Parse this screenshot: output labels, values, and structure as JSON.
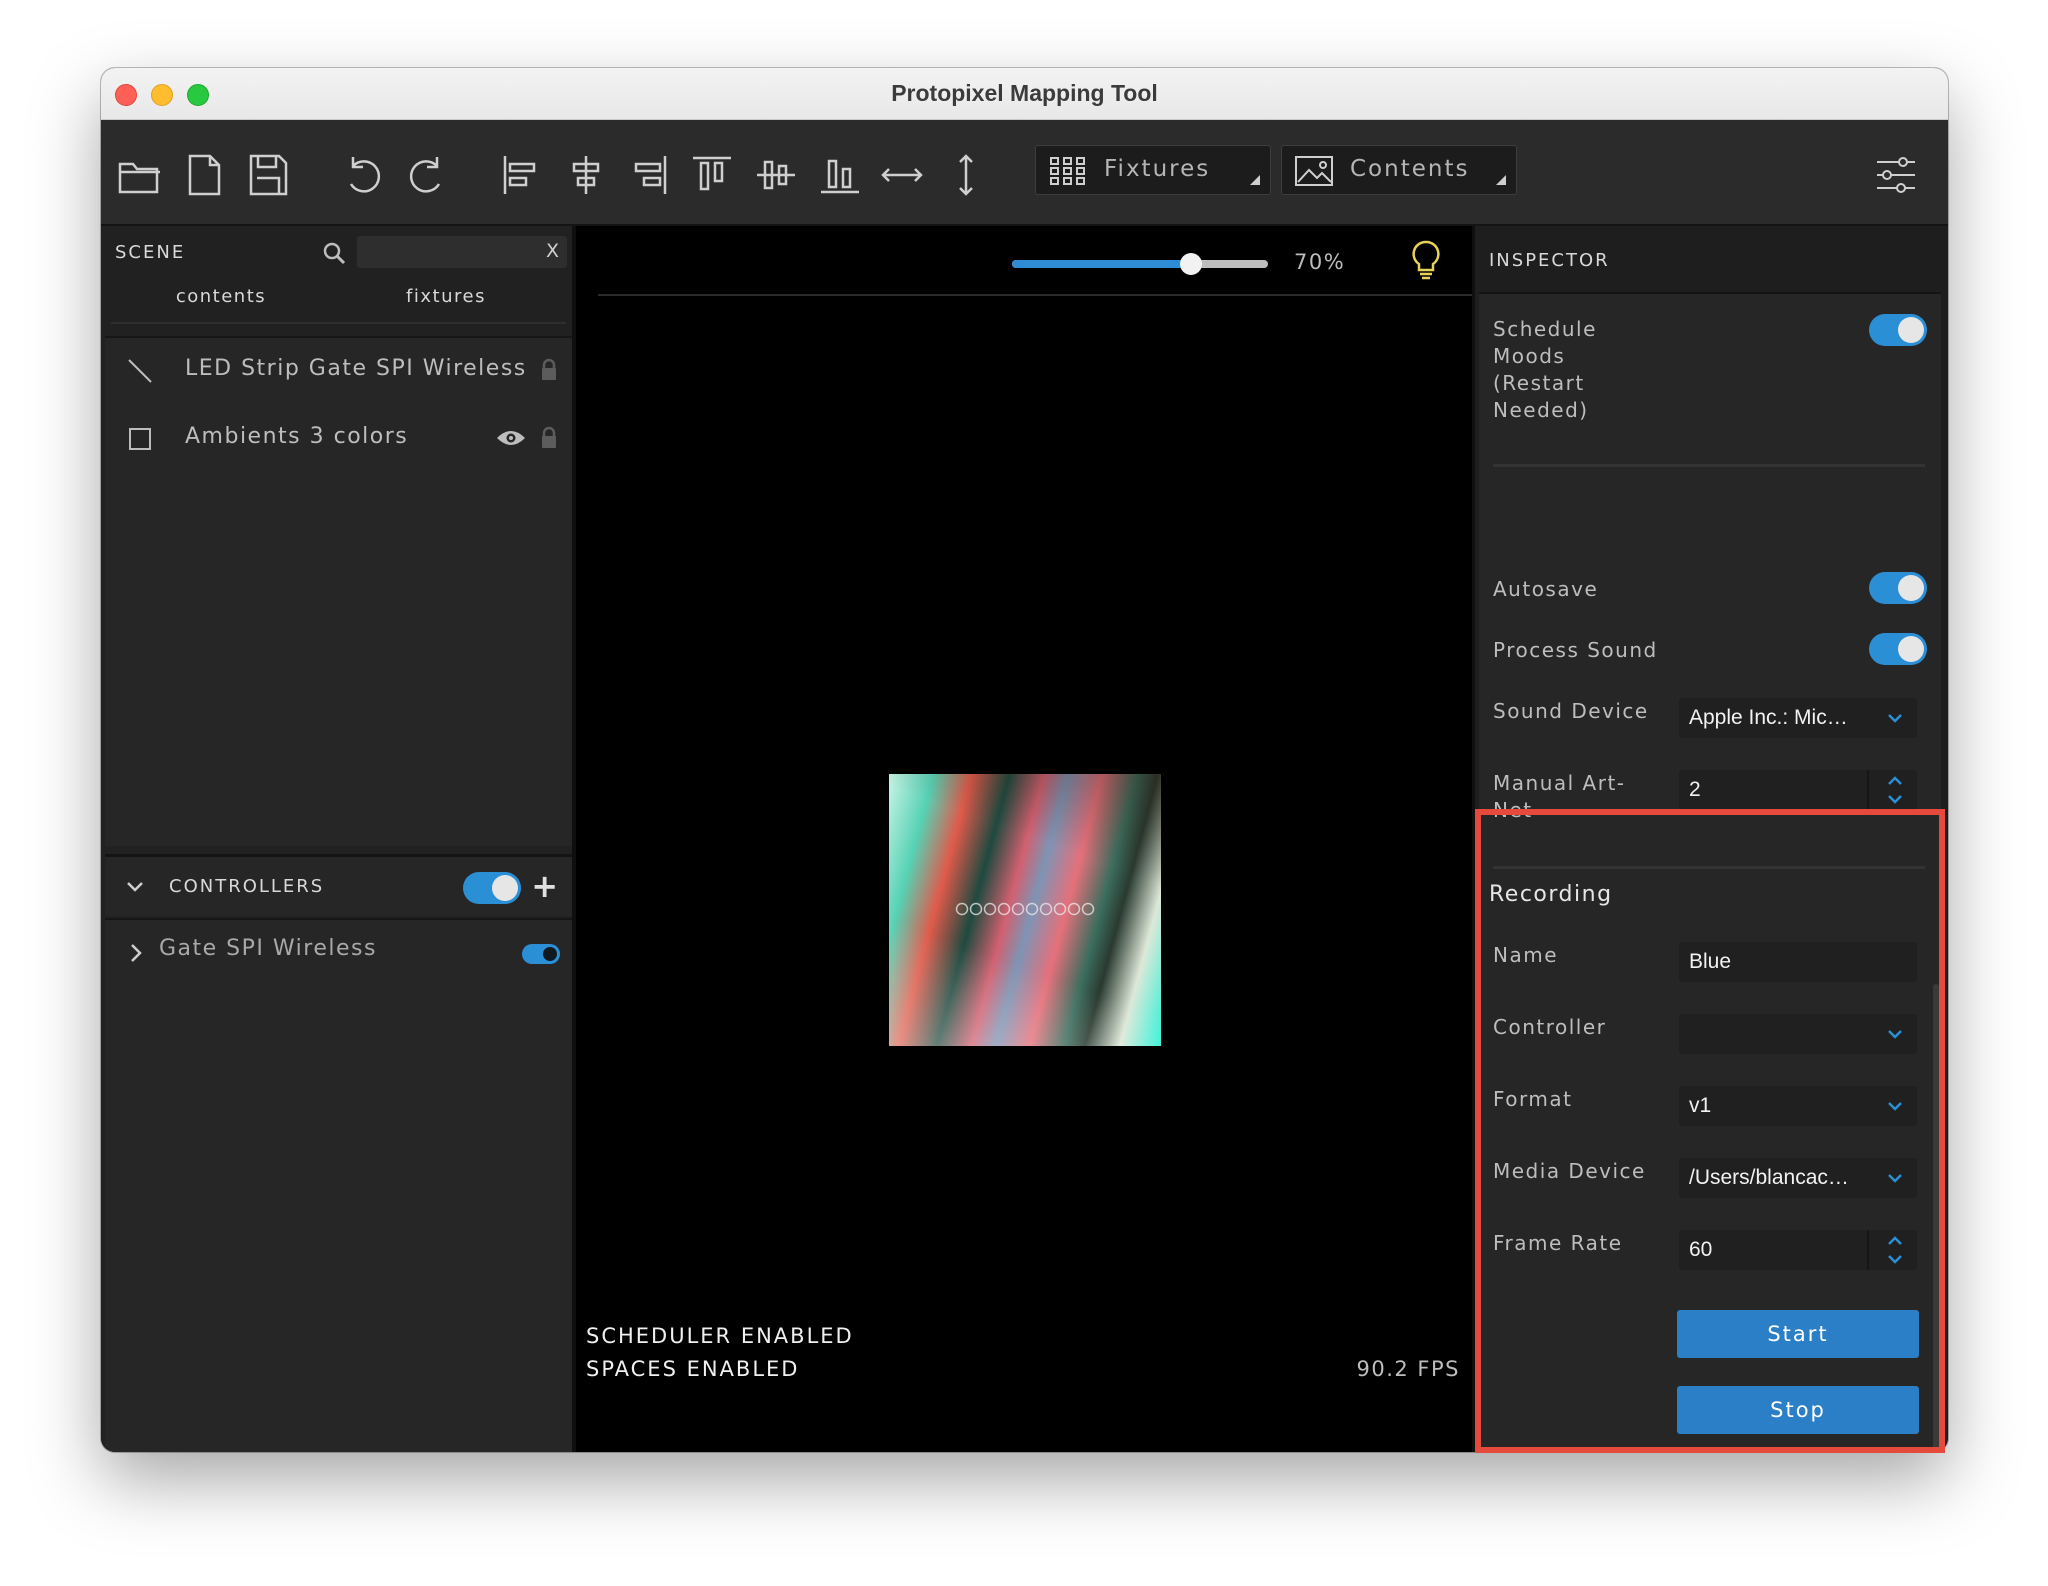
{
  "window": {
    "title": "Protopixel Mapping Tool"
  },
  "toolbar": {
    "icons": [
      "open-folder-icon",
      "new-file-icon",
      "save-icon",
      "undo-icon",
      "redo-icon",
      "align-left-icon",
      "align-center-h-icon",
      "align-right-icon",
      "align-top-icon",
      "align-center-v-icon",
      "align-bottom-icon",
      "distribute-horizontal-icon",
      "distribute-vertical-icon"
    ],
    "fixtures_label": "Fixtures",
    "contents_label": "Contents"
  },
  "scene": {
    "title": "SCENE",
    "search_clear": "X",
    "tabs": [
      "contents",
      "fixtures"
    ],
    "items": [
      {
        "label": "LED Strip Gate SPI Wireless",
        "icon": "line-icon",
        "locked": true,
        "visible_icon": false
      },
      {
        "label": "Ambients 3 colors",
        "icon": "square-icon",
        "locked": true,
        "visible_icon": true
      }
    ]
  },
  "controllers": {
    "title": "CONTROLLERS",
    "enabled": true,
    "items": [
      {
        "label": "Gate SPI Wireless",
        "enabled": true
      }
    ]
  },
  "canvas": {
    "zoom_percent": 70,
    "zoom_label": "70%",
    "status_lines": [
      "SCHEDULER ENABLED",
      "SPACES ENABLED"
    ],
    "fps": "90.2 FPS"
  },
  "inspector": {
    "title": "INSPECTOR",
    "schedule_moods_label": "Schedule Moods (Restart Needed)",
    "schedule_moods_on": true,
    "autosave_label": "Autosave",
    "autosave_on": true,
    "process_sound_label": "Process Sound",
    "process_sound_on": true,
    "sound_device_label": "Sound Device",
    "sound_device_value": "Apple Inc.: Mic…",
    "manual_artnet_label": "Manual Art-Net",
    "manual_artnet_value": "2"
  },
  "recording": {
    "title": "Recording",
    "name_label": "Name",
    "name_value": "Blue",
    "controller_label": "Controller",
    "controller_value": "",
    "format_label": "Format",
    "format_value": "v1",
    "media_device_label": "Media Device",
    "media_device_value": "/Users/blancac…",
    "frame_rate_label": "Frame Rate",
    "frame_rate_value": "60",
    "start_label": "Start",
    "stop_label": "Stop"
  },
  "colors": {
    "accent": "#2b8fd6",
    "button": "#2a7fc6",
    "highlight": "#e64a3c"
  }
}
